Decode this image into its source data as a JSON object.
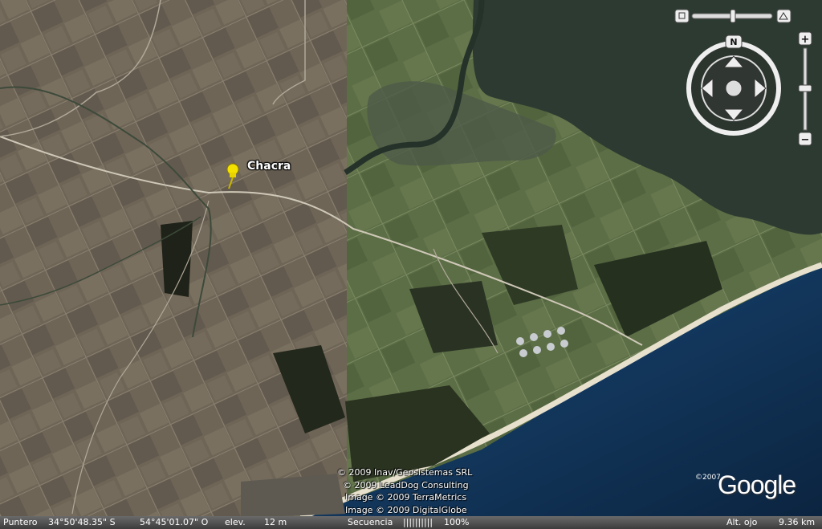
{
  "placemark": {
    "label": "Chacra",
    "icon": "yellow-pushpin-icon"
  },
  "credits": [
    "© 2009 Inav/Geosistemas SRL",
    "© 2009 LeadDog Consulting",
    "Image © 2009 TerraMetrics",
    "Image © 2009 DigitalGlobe"
  ],
  "logo": {
    "copyright": "©2007",
    "word": "Google"
  },
  "status": {
    "pointer_label": "Puntero",
    "latitude": "34°50'48.35\" S",
    "longitude": "54°45'01.07\" O",
    "elev_label": "elev.",
    "elev_value": "12 m",
    "stream_label": "Secuencia",
    "stream_bars": "||||||||||",
    "stream_percent": "100%",
    "eye_label": "Alt. ojo",
    "eye_value": "9.36 km"
  },
  "nav": {
    "north_label": "N",
    "zoom_in": "+",
    "zoom_out": "−"
  },
  "colors": {
    "sea": "#0f2a4a",
    "lagoon": "#2c3a30",
    "beach": "#e6e0cc",
    "land_left": "#6e6456",
    "land_right": "#5a6e44"
  }
}
